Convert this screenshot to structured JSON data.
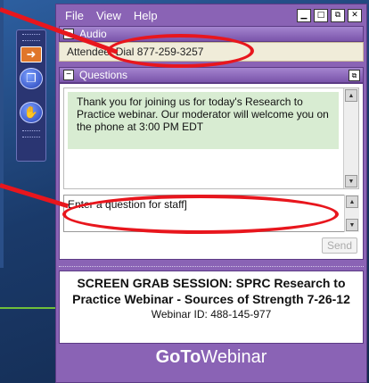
{
  "menu": {
    "file": "File",
    "view": "View",
    "help": "Help"
  },
  "window_controls": {
    "minimize": "▁",
    "maximize": "□",
    "restore": "⧉",
    "close": "✕"
  },
  "audio": {
    "title": "Audio",
    "attendee_label": "Attendee: Dial 877-259-3257"
  },
  "questions": {
    "title": "Questions",
    "message": "Thank you for joining us for today's Research to Practice webinar.  Our moderator will welcome you on the phone at 3:00 PM EDT",
    "input_placeholder": "Enter a question for staff]",
    "send_label": "Send"
  },
  "session": {
    "title": "SCREEN GRAB SESSION: SPRC Research to Practice Webinar - Sources of Strength 7-26-12",
    "webinar_id": "Webinar ID: 488-145-977"
  },
  "brand": {
    "bold": "GoTo",
    "light": "Webinar"
  },
  "toolbar_icons": [
    "arrow-icon",
    "window-icon",
    "hand-raise-icon"
  ],
  "colors": {
    "panel_purple": "#8a63b5",
    "annotation_red": "#e8161d",
    "message_green": "#d8ecd2",
    "arrow_orange": "#e0762a"
  }
}
